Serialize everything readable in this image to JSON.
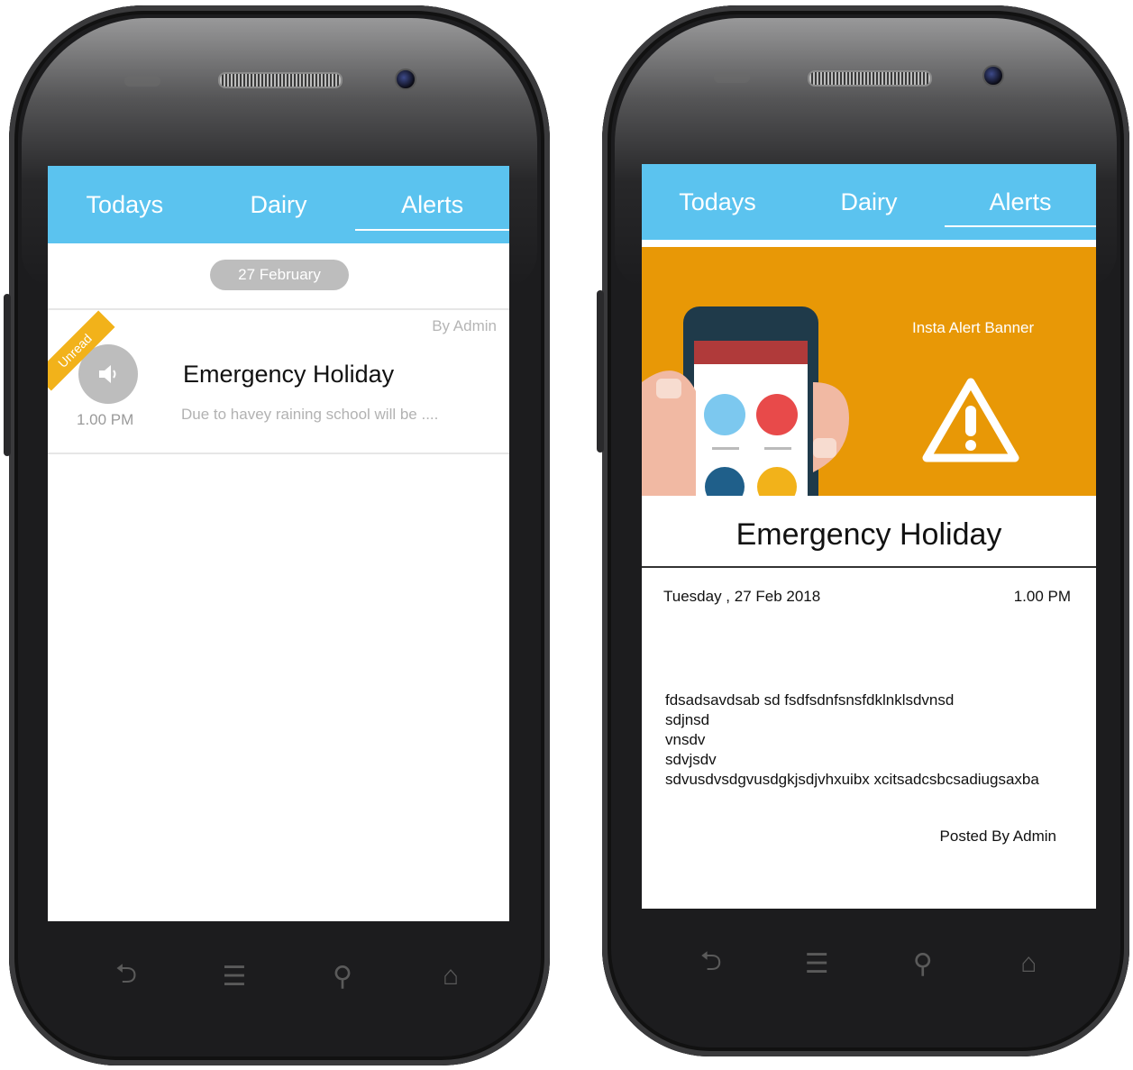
{
  "left_phone": {
    "tabs": [
      {
        "label": "Todays",
        "active": false
      },
      {
        "label": "Dairy",
        "active": false
      },
      {
        "label": "Alerts",
        "active": true
      }
    ],
    "date_pill": "27 February",
    "alert": {
      "badge": "Unread",
      "author": "By Admin",
      "title": "Emergency Holiday",
      "time": "1.00 PM",
      "preview": "Due to havey raining school will be ...."
    },
    "nav_keys": [
      "back-icon",
      "menu-icon",
      "search-icon",
      "home-icon"
    ]
  },
  "right_phone": {
    "tabs": [
      {
        "label": "Todays",
        "active": false
      },
      {
        "label": "Dairy",
        "active": false
      },
      {
        "label": "Alerts",
        "active": true
      }
    ],
    "banner_label": "Insta Alert Banner",
    "title": "Emergency Holiday",
    "date": "Tuesday , 27 Feb 2018",
    "time": "1.00 PM",
    "body_lines": [
      "fdsadsavdsab sd fsdfsdnfsnsfdklnklsdvnsd",
      "sdjnsd",
      "vnsdv",
      "sdvjsdv",
      "sdvusdvsdgvusdgkjsdjvhxuibx xcitsadcsbcsadiugsaxba"
    ],
    "posted_by": "Posted By Admin",
    "nav_keys": [
      "back-icon",
      "menu-icon",
      "search-icon",
      "home-icon"
    ]
  },
  "colors": {
    "tab_bar": "#5bc3ef",
    "banner": "#e89806",
    "ribbon": "#f2b21a",
    "pill": "#bdbdbd"
  }
}
